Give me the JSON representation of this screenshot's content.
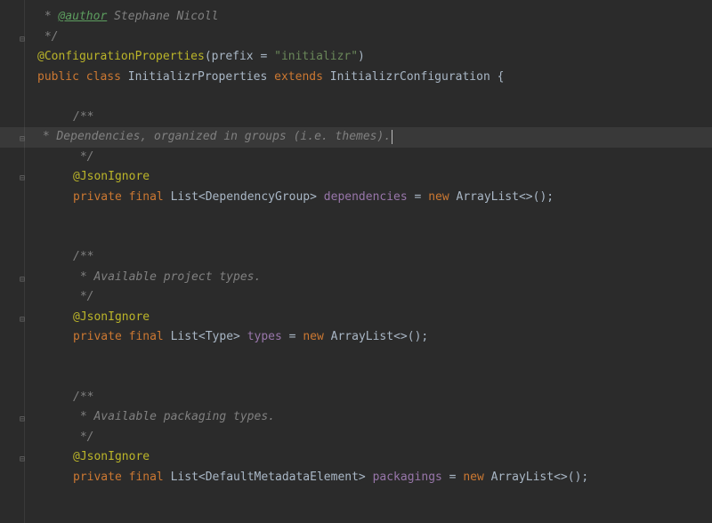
{
  "editor": {
    "lines": {
      "l0": " * ",
      "author_tag": "@author",
      "author_name": " Stephane Nicoll",
      "l1": " */",
      "anno_cp": "@ConfigurationProperties",
      "cp_open": "(",
      "cp_prefix": "prefix",
      "cp_eq": " = ",
      "cp_value": "\"initializr\"",
      "cp_close": ")",
      "kw_public": "public ",
      "kw_class": "class ",
      "class_name": "InitializrProperties ",
      "kw_extends": "extends ",
      "super_name": "InitializrConfiguration ",
      "brace_open": "{",
      "block1_open": "/**",
      "block1_body": " * Dependencies, organized in groups (i.e. themes).",
      "block1_close": " */",
      "anno_json": "@JsonIgnore",
      "kw_private": "private ",
      "kw_final": "final ",
      "type_list": "List",
      "gen_open": "<",
      "type_depgroup": "DependencyGroup",
      "gen_close": ">",
      "var_deps": " dependencies",
      "eq": " = ",
      "kw_new": "new ",
      "type_arraylist": "ArrayList",
      "diamond": "<>",
      "stmt_end": "();",
      "block2_open": "/**",
      "block2_body": " * Available project types.",
      "block2_close": " */",
      "type_type": "Type",
      "var_types": " types",
      "block3_open": "/**",
      "block3_body": " * Available packaging types.",
      "block3_close": " */",
      "type_dme": "DefaultMetadataElement",
      "var_packagings": " packagings"
    }
  }
}
